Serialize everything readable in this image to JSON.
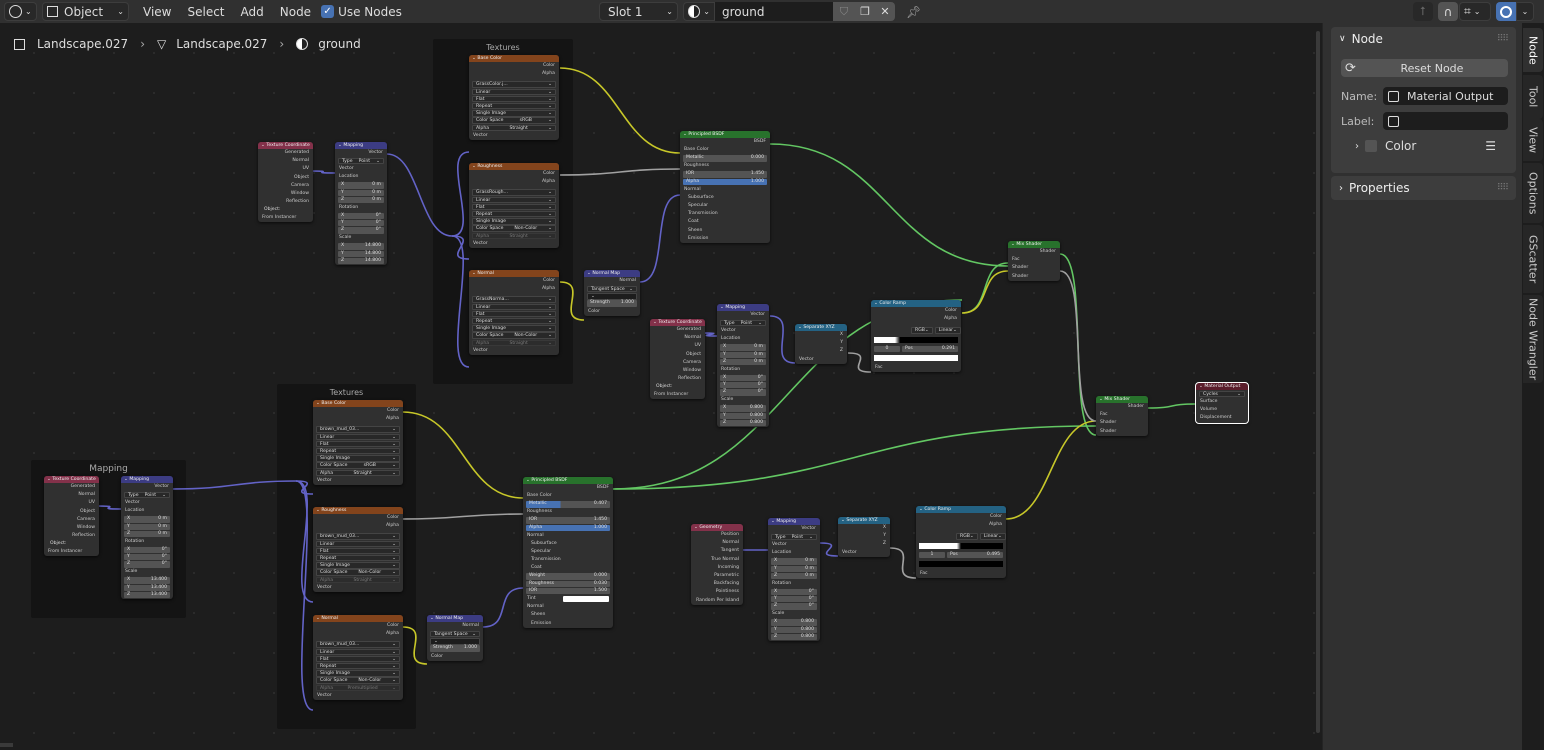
{
  "header": {
    "editor_type_icon": "node-editor-icon",
    "mode": "Object",
    "menus": [
      "View",
      "Select",
      "Add",
      "Node"
    ],
    "use_nodes_label": "Use Nodes",
    "use_nodes_checked": true,
    "slot": "Slot 1",
    "material_name": "ground",
    "right_icons": [
      "parent-node-icon",
      "snap-icon",
      "snap-target-icon",
      "overlay-icon"
    ]
  },
  "breadcrumb": {
    "items": [
      "Landscape.027",
      "Landscape.027",
      "ground"
    ]
  },
  "colors": {
    "shader_link": "#63c763",
    "color_link": "#c7c729",
    "vector_link": "#6363c7",
    "float_link": "#a1a1a1",
    "accent": "#4772b3"
  },
  "frames": [
    {
      "label": "Textures"
    },
    {
      "label": "Textures"
    },
    {
      "label": "Mapping"
    }
  ],
  "nodes": {
    "tc1": {
      "title": "Texture Coordinate",
      "outputs": [
        "Generated",
        "Normal",
        "UV",
        "Object",
        "Camera",
        "Window",
        "Reflection"
      ],
      "object_label": "Object:",
      "from_instancer": "From Instancer"
    },
    "map1": {
      "title": "Mapping",
      "out": "Vector",
      "type_label": "Type",
      "type": "Point",
      "vector": "Vector",
      "location": "Location",
      "rotation": "Rotation",
      "scale": "Scale",
      "loc": [
        "0 m",
        "0 m",
        "0 m"
      ],
      "rot": [
        "0°",
        "0°",
        "0°"
      ],
      "scl": [
        "14.800",
        "14.800",
        "14.800"
      ],
      "axes": [
        "X",
        "Y",
        "Z"
      ]
    },
    "tex_base1": {
      "title": "Base Color",
      "color": "Color",
      "alpha": "Alpha",
      "image": "GrassColor.j...",
      "users": "2",
      "interp": "Linear",
      "proj": "Flat",
      "ext": "Repeat",
      "src": "Single Image",
      "cs_label": "Color Space",
      "cs": "sRGB",
      "alpha_label": "Alpha",
      "alpha_mode": "Straight",
      "vector": "Vector"
    },
    "tex_rough1": {
      "title": "Roughness",
      "color": "Color",
      "alpha": "Alpha",
      "image": "GrassRough...",
      "users": "2",
      "interp": "Linear",
      "proj": "Flat",
      "ext": "Repeat",
      "src": "Single Image",
      "cs_label": "Color Space",
      "cs": "Non-Color",
      "alpha_label": "Alpha",
      "alpha_mode": "Straight",
      "vector": "Vector"
    },
    "tex_norm1": {
      "title": "Normal",
      "color": "Color",
      "alpha": "Alpha",
      "image": "GrassNorma...",
      "users": "2",
      "interp": "Linear",
      "proj": "Flat",
      "ext": "Repeat",
      "src": "Single Image",
      "cs_label": "Color Space",
      "cs": "Non-Color",
      "alpha_label": "Alpha",
      "alpha_mode": "Straight",
      "vector": "Vector"
    },
    "nmap1": {
      "title": "Normal Map",
      "out": "Normal",
      "space": "Tangent Space",
      "strength_label": "Strength",
      "strength": "1.000",
      "color": "Color"
    },
    "bsdf1": {
      "title": "Principled BSDF",
      "out": "BSDF",
      "base": "Base Color",
      "metallic_label": "Metallic",
      "metallic": "0.000",
      "roughness": "Roughness",
      "ior_label": "IOR",
      "ior": "1.450",
      "alpha_label": "Alpha",
      "alpha": "1.000",
      "normal": "Normal",
      "panels": [
        "Subsurface",
        "Specular",
        "Transmission",
        "Coat",
        "Sheen",
        "Emission"
      ]
    },
    "tc2": {
      "title": "Texture Coordinate",
      "outputs": [
        "Generated",
        "Normal",
        "UV",
        "Object",
        "Camera",
        "Window",
        "Reflection"
      ],
      "object_label": "Object:",
      "from_instancer": "From Instancer"
    },
    "map2": {
      "title": "Mapping",
      "out": "Vector",
      "type_label": "Type",
      "type": "Point",
      "vector": "Vector",
      "location": "Location",
      "rotation": "Rotation",
      "scale": "Scale",
      "loc": [
        "0 m",
        "0 m",
        "0 m"
      ],
      "rot": [
        "0°",
        "0°",
        "0°"
      ],
      "scl": [
        "0.800",
        "0.800",
        "0.800"
      ],
      "axes": [
        "X",
        "Y",
        "Z"
      ]
    },
    "sep1": {
      "title": "Separate XYZ",
      "outputs": [
        "X",
        "Y",
        "Z"
      ],
      "in": "Vector"
    },
    "ramp1": {
      "title": "Color Ramp",
      "color": "Color",
      "alpha": "Alpha",
      "mode": "RGB",
      "interp": "Linear",
      "index": "0",
      "pos_label": "Pos",
      "pos": "0.291",
      "fac": "Fac"
    },
    "mix1": {
      "title": "Mix Shader",
      "out": "Shader",
      "inputs": [
        "Fac",
        "Shader",
        "Shader"
      ]
    },
    "mix2": {
      "title": "Mix Shader",
      "out": "Shader",
      "inputs": [
        "Fac",
        "Shader",
        "Shader"
      ]
    },
    "out": {
      "title": "Material Output",
      "target": "Cycles",
      "inputs": [
        "Surface",
        "Volume",
        "Displacement"
      ]
    },
    "tc3": {
      "title": "Texture Coordinate",
      "outputs": [
        "Generated",
        "Normal",
        "UV",
        "Object",
        "Camera",
        "Window",
        "Reflection"
      ],
      "object_label": "Object:",
      "from_instancer": "From Instancer"
    },
    "map3": {
      "title": "Mapping",
      "out": "Vector",
      "type_label": "Type",
      "type": "Point",
      "vector": "Vector",
      "location": "Location",
      "rotation": "Rotation",
      "scale": "Scale",
      "loc": [
        "0 m",
        "0 m",
        "0 m"
      ],
      "rot": [
        "0°",
        "0°",
        "0°"
      ],
      "scl": [
        "13.400",
        "13.400",
        "13.400"
      ],
      "axes": [
        "X",
        "Y",
        "Z"
      ]
    },
    "tex_base2": {
      "title": "Base Color",
      "color": "Color",
      "alpha": "Alpha",
      "image": "brown_mud_03...",
      "interp": "Linear",
      "proj": "Flat",
      "ext": "Repeat",
      "src": "Single Image",
      "cs_label": "Color Space",
      "cs": "sRGB",
      "alpha_label": "Alpha",
      "alpha_mode": "Straight",
      "vector": "Vector"
    },
    "tex_rough2": {
      "title": "Roughness",
      "color": "Color",
      "alpha": "Alpha",
      "image": "brown_mud_03...",
      "interp": "Linear",
      "proj": "Flat",
      "ext": "Repeat",
      "src": "Single Image",
      "cs_label": "Color Space",
      "cs": "Non-Color",
      "alpha_label": "Alpha",
      "alpha_mode": "Straight",
      "vector": "Vector"
    },
    "tex_norm2": {
      "title": "Normal",
      "color": "Color",
      "alpha": "Alpha",
      "image": "brown_mud_03...",
      "interp": "Linear",
      "proj": "Flat",
      "ext": "Repeat",
      "src": "Single Image",
      "cs_label": "Color Space",
      "cs": "Non-Color",
      "alpha_label": "Alpha",
      "alpha_mode": "Premultiplied",
      "vector": "Vector"
    },
    "nmap2": {
      "title": "Normal Map",
      "out": "Normal",
      "space": "Tangent Space",
      "strength_label": "Strength",
      "strength": "1.000",
      "color": "Color"
    },
    "bsdf2": {
      "title": "Principled BSDF",
      "out": "BSDF",
      "base": "Base Color",
      "metallic_label": "Metallic",
      "metallic": "0.407",
      "roughness": "Roughness",
      "ior_label": "IOR",
      "ior": "1.450",
      "alpha_label": "Alpha",
      "alpha": "1.000",
      "normal": "Normal",
      "panels_top": [
        "Subsurface",
        "Specular",
        "Transmission"
      ],
      "coat": "Coat",
      "coat_weight_label": "Weight",
      "coat_weight": "0.000",
      "coat_rough_label": "Roughness",
      "coat_rough": "0.030",
      "coat_ior_label": "IOR",
      "coat_ior": "1.500",
      "tint": "Tint",
      "coat_normal": "Normal",
      "panels_bottom": [
        "Sheen",
        "Emission"
      ]
    },
    "geo": {
      "title": "Geometry",
      "outputs": [
        "Position",
        "Normal",
        "Tangent",
        "True Normal",
        "Incoming",
        "Parametric",
        "Backfacing",
        "Pointiness",
        "Random Per Island"
      ]
    },
    "map4": {
      "title": "Mapping",
      "out": "Vector",
      "type_label": "Type",
      "type": "Point",
      "vector": "Vector",
      "location": "Location",
      "rotation": "Rotation",
      "scale": "Scale",
      "loc": [
        "0 m",
        "0 m",
        "0 m"
      ],
      "rot": [
        "0°",
        "0°",
        "0°"
      ],
      "scl": [
        "0.800",
        "0.800",
        "0.800"
      ],
      "axes": [
        "X",
        "Y",
        "Z"
      ]
    },
    "sep2": {
      "title": "Separate XYZ",
      "outputs": [
        "X",
        "Y",
        "Z"
      ],
      "in": "Vector"
    },
    "ramp2": {
      "title": "Color Ramp",
      "color": "Color",
      "alpha": "Alpha",
      "mode": "RGB",
      "interp": "Linear",
      "index": "1",
      "pos_label": "Pos",
      "pos": "0.495",
      "fac": "Fac"
    }
  },
  "npanel": {
    "node_panel_title": "Node",
    "reset_label": "Reset Node",
    "name_label": "Name:",
    "name_value": "Material Output",
    "label_label": "Label:",
    "label_value": "",
    "color_label": "Color",
    "properties_label": "Properties"
  },
  "tabs": [
    "Node",
    "Tool",
    "View",
    "Options",
    "GScatter",
    "Node Wrangler"
  ],
  "active_tab": "Node"
}
